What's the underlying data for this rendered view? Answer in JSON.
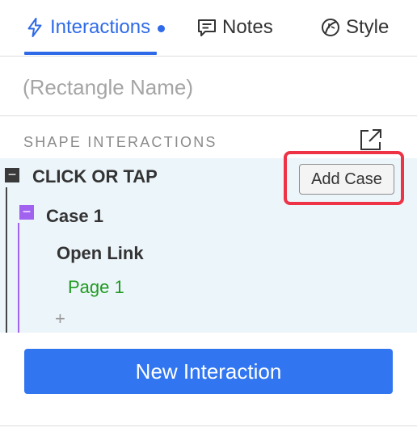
{
  "tabs": {
    "interactions": "Interactions",
    "notes": "Notes",
    "style": "Style"
  },
  "name_field": {
    "placeholder": "(Rectangle Name)"
  },
  "section": {
    "title": "SHAPE INTERACTIONS"
  },
  "interaction": {
    "collapse_symbol": "−",
    "event": "CLICK OR TAP",
    "add_case": "Add Case",
    "case": {
      "collapse_symbol": "−",
      "label": "Case 1",
      "action": "Open Link",
      "target": "Page 1",
      "add_action": "+"
    }
  },
  "new_interaction": "New Interaction",
  "colors": {
    "accent": "#2f6ae8",
    "primary_button": "#3176f0",
    "case_purple": "#a262f0",
    "target_green": "#1f9a1f",
    "highlight_red": "#ee3347",
    "panel_bg": "#ecf5fa"
  },
  "icons": {
    "interactions": "lightning-icon",
    "notes": "speech-bubble-icon",
    "style": "leaf-icon",
    "popout": "external-link-icon"
  }
}
